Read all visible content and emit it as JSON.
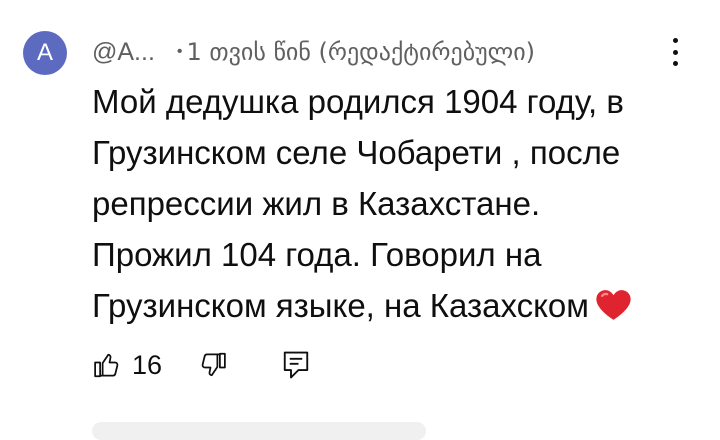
{
  "author": {
    "avatar_letter": "A",
    "handle": "@A...",
    "bullet": "•",
    "time_ago": "1 თვის წინ (რედაქტირებული)"
  },
  "comment": {
    "lines": [
      "Мой дедушка родился 1904 году, в",
      "Грузинском селе Чобарети , после",
      "репрессии жил в Казахстане.",
      "Прожил 104 года. Говорил на",
      "Грузинском языке, на Казахском"
    ],
    "emoji": "red-heart-emoji"
  },
  "actions": {
    "like_count": "16"
  },
  "icons": [
    "kebab-menu-icon",
    "thumbs-up-icon",
    "thumbs-down-icon",
    "reply-icon"
  ],
  "colors": {
    "avatar_bg": "#5c6bc0",
    "meta_text": "#606060",
    "heart": "#e0242f"
  }
}
